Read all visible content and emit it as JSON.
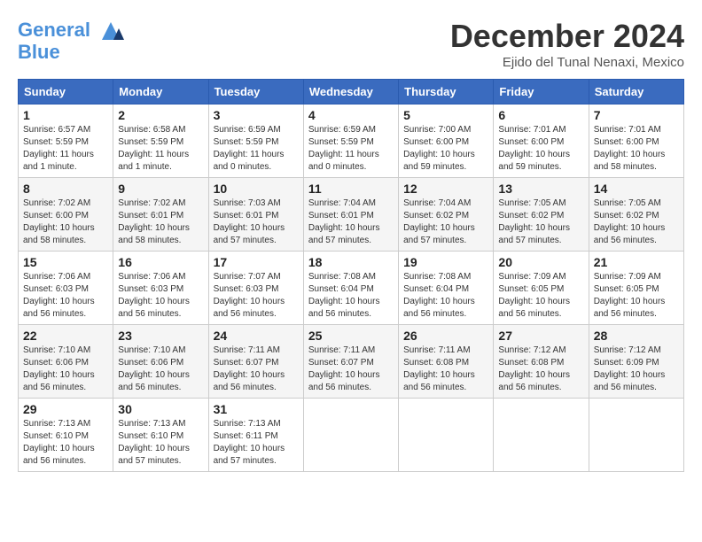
{
  "header": {
    "logo_line1": "General",
    "logo_line2": "Blue",
    "month": "December 2024",
    "location": "Ejido del Tunal Nenaxi, Mexico"
  },
  "weekdays": [
    "Sunday",
    "Monday",
    "Tuesday",
    "Wednesday",
    "Thursday",
    "Friday",
    "Saturday"
  ],
  "weeks": [
    [
      {
        "day": "1",
        "sunrise": "6:57 AM",
        "sunset": "5:59 PM",
        "daylight": "11 hours and 1 minute."
      },
      {
        "day": "2",
        "sunrise": "6:58 AM",
        "sunset": "5:59 PM",
        "daylight": "11 hours and 1 minute."
      },
      {
        "day": "3",
        "sunrise": "6:59 AM",
        "sunset": "5:59 PM",
        "daylight": "11 hours and 0 minutes."
      },
      {
        "day": "4",
        "sunrise": "6:59 AM",
        "sunset": "5:59 PM",
        "daylight": "11 hours and 0 minutes."
      },
      {
        "day": "5",
        "sunrise": "7:00 AM",
        "sunset": "6:00 PM",
        "daylight": "10 hours and 59 minutes."
      },
      {
        "day": "6",
        "sunrise": "7:01 AM",
        "sunset": "6:00 PM",
        "daylight": "10 hours and 59 minutes."
      },
      {
        "day": "7",
        "sunrise": "7:01 AM",
        "sunset": "6:00 PM",
        "daylight": "10 hours and 58 minutes."
      }
    ],
    [
      {
        "day": "8",
        "sunrise": "7:02 AM",
        "sunset": "6:00 PM",
        "daylight": "10 hours and 58 minutes."
      },
      {
        "day": "9",
        "sunrise": "7:02 AM",
        "sunset": "6:01 PM",
        "daylight": "10 hours and 58 minutes."
      },
      {
        "day": "10",
        "sunrise": "7:03 AM",
        "sunset": "6:01 PM",
        "daylight": "10 hours and 57 minutes."
      },
      {
        "day": "11",
        "sunrise": "7:04 AM",
        "sunset": "6:01 PM",
        "daylight": "10 hours and 57 minutes."
      },
      {
        "day": "12",
        "sunrise": "7:04 AM",
        "sunset": "6:02 PM",
        "daylight": "10 hours and 57 minutes."
      },
      {
        "day": "13",
        "sunrise": "7:05 AM",
        "sunset": "6:02 PM",
        "daylight": "10 hours and 57 minutes."
      },
      {
        "day": "14",
        "sunrise": "7:05 AM",
        "sunset": "6:02 PM",
        "daylight": "10 hours and 56 minutes."
      }
    ],
    [
      {
        "day": "15",
        "sunrise": "7:06 AM",
        "sunset": "6:03 PM",
        "daylight": "10 hours and 56 minutes."
      },
      {
        "day": "16",
        "sunrise": "7:06 AM",
        "sunset": "6:03 PM",
        "daylight": "10 hours and 56 minutes."
      },
      {
        "day": "17",
        "sunrise": "7:07 AM",
        "sunset": "6:03 PM",
        "daylight": "10 hours and 56 minutes."
      },
      {
        "day": "18",
        "sunrise": "7:08 AM",
        "sunset": "6:04 PM",
        "daylight": "10 hours and 56 minutes."
      },
      {
        "day": "19",
        "sunrise": "7:08 AM",
        "sunset": "6:04 PM",
        "daylight": "10 hours and 56 minutes."
      },
      {
        "day": "20",
        "sunrise": "7:09 AM",
        "sunset": "6:05 PM",
        "daylight": "10 hours and 56 minutes."
      },
      {
        "day": "21",
        "sunrise": "7:09 AM",
        "sunset": "6:05 PM",
        "daylight": "10 hours and 56 minutes."
      }
    ],
    [
      {
        "day": "22",
        "sunrise": "7:10 AM",
        "sunset": "6:06 PM",
        "daylight": "10 hours and 56 minutes."
      },
      {
        "day": "23",
        "sunrise": "7:10 AM",
        "sunset": "6:06 PM",
        "daylight": "10 hours and 56 minutes."
      },
      {
        "day": "24",
        "sunrise": "7:11 AM",
        "sunset": "6:07 PM",
        "daylight": "10 hours and 56 minutes."
      },
      {
        "day": "25",
        "sunrise": "7:11 AM",
        "sunset": "6:07 PM",
        "daylight": "10 hours and 56 minutes."
      },
      {
        "day": "26",
        "sunrise": "7:11 AM",
        "sunset": "6:08 PM",
        "daylight": "10 hours and 56 minutes."
      },
      {
        "day": "27",
        "sunrise": "7:12 AM",
        "sunset": "6:08 PM",
        "daylight": "10 hours and 56 minutes."
      },
      {
        "day": "28",
        "sunrise": "7:12 AM",
        "sunset": "6:09 PM",
        "daylight": "10 hours and 56 minutes."
      }
    ],
    [
      {
        "day": "29",
        "sunrise": "7:13 AM",
        "sunset": "6:10 PM",
        "daylight": "10 hours and 56 minutes."
      },
      {
        "day": "30",
        "sunrise": "7:13 AM",
        "sunset": "6:10 PM",
        "daylight": "10 hours and 57 minutes."
      },
      {
        "day": "31",
        "sunrise": "7:13 AM",
        "sunset": "6:11 PM",
        "daylight": "10 hours and 57 minutes."
      },
      null,
      null,
      null,
      null
    ]
  ]
}
